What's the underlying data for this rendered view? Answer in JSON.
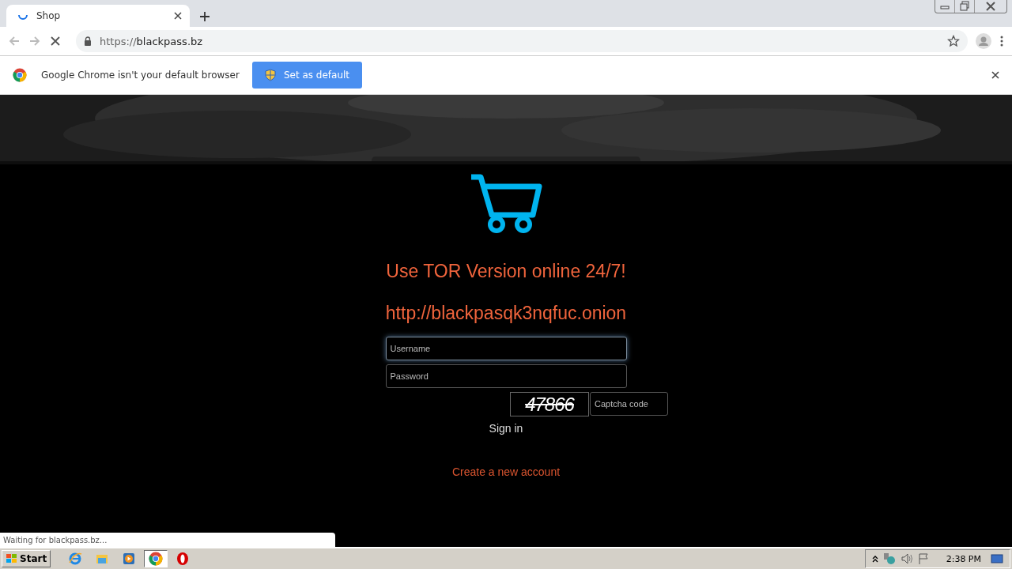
{
  "browser": {
    "tabs": [
      {
        "title": "Shop",
        "selected": true,
        "loading": true
      }
    ],
    "address": {
      "scheme": "https://",
      "host": "blackpass.bz"
    },
    "loading": true
  },
  "infobar": {
    "message": "Google Chrome isn't your default browser",
    "button": "Set as default"
  },
  "page": {
    "heading": "Use TOR Version online 24/7!",
    "onion_url": "http://blackpasqk3nqfuc.onion",
    "username": {
      "placeholder": "Username",
      "focused": true
    },
    "password": {
      "placeholder": "Password"
    },
    "captcha_text": "47866",
    "captcha": {
      "placeholder": "Captcha code"
    },
    "sign_in": "Sign in",
    "create_account": "Create a new account"
  },
  "status_bubble": "Waiting for blackpass.bz...",
  "taskbar": {
    "start": "Start",
    "apps": [
      {
        "kind": "ie",
        "selected": false
      },
      {
        "kind": "explorer",
        "selected": false
      },
      {
        "kind": "media",
        "selected": false
      },
      {
        "kind": "chrome",
        "selected": true
      },
      {
        "kind": "opera",
        "selected": false
      }
    ],
    "clock": "2:38 PM"
  }
}
